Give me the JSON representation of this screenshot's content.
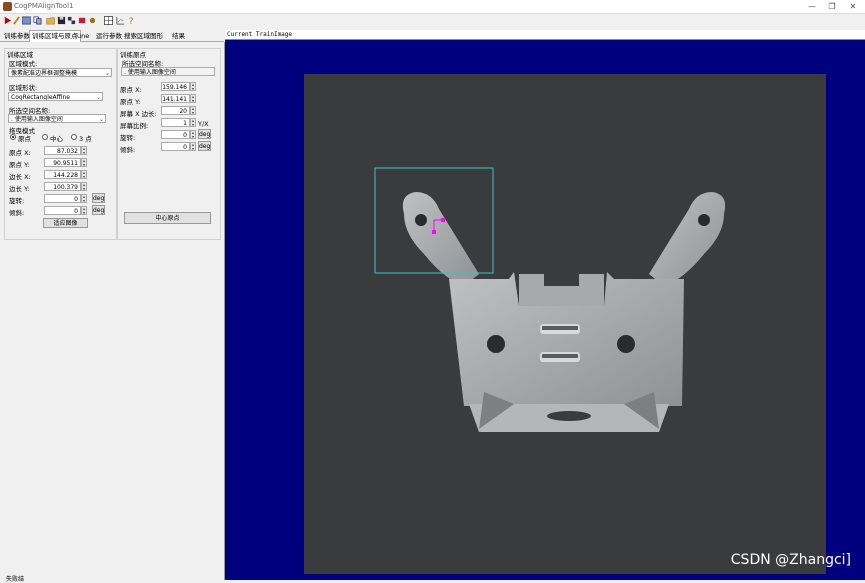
{
  "window": {
    "title": "CogPMAlignTool1",
    "minimize": "—",
    "maximize": "❐",
    "close": "✕"
  },
  "tabs": [
    "训练参数",
    "训练区域与原点",
    "Tune",
    "运行参数",
    "搜索区域",
    "图形",
    "结果"
  ],
  "active_tab": 1,
  "region": {
    "group_title": "训练区域",
    "mode_label": "区域模式:",
    "mode_value": "像素配准边界框调整掩模",
    "shape_label": "区域形状:",
    "shape_value": "CogRectangleAffine",
    "space_label": "所选空间名称:",
    "space_value": ". 使用输入图像空间",
    "drag_label": "拖曳模式",
    "drag_options": [
      "原点",
      "中心",
      "3 点"
    ],
    "drag_selected": 0,
    "fields": [
      {
        "label": "原点 X:",
        "value": "87.032"
      },
      {
        "label": "原点 Y:",
        "value": "90.9511"
      },
      {
        "label": "边长 X:",
        "value": "144.228"
      },
      {
        "label": "边长 Y:",
        "value": "100.379"
      },
      {
        "label": "旋转:",
        "value": "0",
        "unit": "deg"
      },
      {
        "label": "倾斜:",
        "value": "0",
        "unit": "deg"
      }
    ],
    "fit_button": "适应图像"
  },
  "origin": {
    "group_title": "训练原点",
    "space_label": "所选空间名称:",
    "space_value": ". 使用输入图像空间",
    "fields": [
      {
        "label": "原点 X:",
        "value": "159.146"
      },
      {
        "label": "原点 Y:",
        "value": "141.141"
      },
      {
        "label": "屏幕 X 边长:",
        "value": "20"
      },
      {
        "label": "屏幕比例:",
        "value": "1",
        "unit": "Y/X"
      },
      {
        "label": "旋转:",
        "value": "0",
        "unit": "deg"
      },
      {
        "label": "倾斜:",
        "value": "0",
        "unit": "deg"
      }
    ],
    "center_button": "中心原点"
  },
  "image": {
    "header": "Current TrainImage"
  },
  "watermark": "CSDN @Zhangci]",
  "bottom_label": "失败结"
}
